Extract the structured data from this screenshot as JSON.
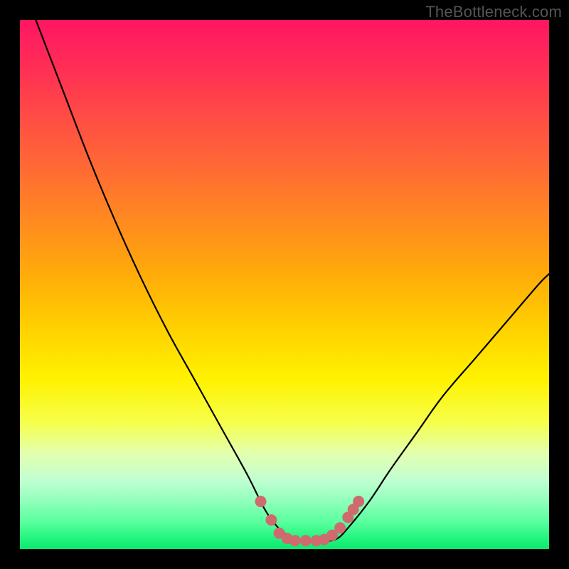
{
  "watermark": "TheBottleneck.com",
  "chart_data": {
    "type": "line",
    "title": "",
    "xlabel": "",
    "ylabel": "",
    "xlim": [
      0,
      100
    ],
    "ylim": [
      0,
      100
    ],
    "grid": false,
    "legend": false,
    "series": [
      {
        "name": "curve",
        "color": "#000000",
        "x": [
          3,
          8,
          13,
          18,
          23,
          28,
          33,
          38,
          43,
          46,
          48,
          50,
          53,
          56,
          58,
          60,
          62,
          66,
          70,
          75,
          80,
          86,
          92,
          98,
          100
        ],
        "y": [
          100,
          87,
          74,
          62,
          51,
          41,
          32,
          23,
          14,
          8,
          5,
          3,
          1.5,
          1.5,
          1.5,
          2,
          4,
          9,
          15,
          22,
          29,
          36,
          43,
          50,
          52
        ]
      }
    ],
    "markers": {
      "name": "highlight-dots",
      "color": "#cf6b6f",
      "points": [
        {
          "x": 45.5,
          "y": 9.0
        },
        {
          "x": 47.5,
          "y": 5.5
        },
        {
          "x": 49.0,
          "y": 3.0
        },
        {
          "x": 50.5,
          "y": 2.0
        },
        {
          "x": 52.0,
          "y": 1.6
        },
        {
          "x": 54.0,
          "y": 1.6
        },
        {
          "x": 56.0,
          "y": 1.6
        },
        {
          "x": 57.5,
          "y": 1.8
        },
        {
          "x": 59.0,
          "y": 2.6
        },
        {
          "x": 60.5,
          "y": 4.0
        },
        {
          "x": 62.0,
          "y": 6.0
        },
        {
          "x": 63.0,
          "y": 7.5
        },
        {
          "x": 64.0,
          "y": 9.0
        }
      ],
      "radius": 8
    }
  }
}
